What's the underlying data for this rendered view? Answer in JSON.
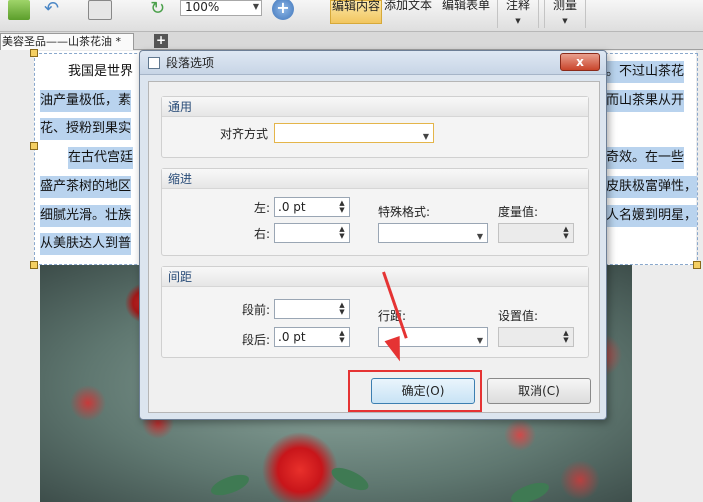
{
  "toolbar": {
    "zoom": "100%",
    "edit_content": "编辑内容",
    "add_text": "添加文本",
    "edit_form": "编辑表单",
    "annotate": "注释",
    "measure": "测量"
  },
  "tabs": {
    "doc_tab": "美容圣品——山茶花油 *",
    "add": "+"
  },
  "document": {
    "lines": [
      "我国是世界",
      "。不过山茶花",
      "油产量极低，素",
      "而山茶果从开",
      "花、授粉到果实",
      "在古代宫廷",
      "奇效。在一些",
      "盛产茶树的地区",
      "皮肤极富弹性，",
      "细腻光滑。壮族",
      "人名媛到明星，",
      "从美肤达人到普"
    ]
  },
  "dialog": {
    "title": "段落选项",
    "close": "x",
    "sections": {
      "general": "通用",
      "indent": "缩进",
      "spacing": "间距"
    },
    "align_label": "对齐方式",
    "align_value": "",
    "left_label": "左:",
    "left_value": ".0 pt",
    "right_label": "右:",
    "right_value": "",
    "special_label": "特殊格式:",
    "measure_label": "度量值:",
    "before_label": "段前:",
    "before_value": "",
    "after_label": "段后:",
    "after_value": ".0 pt",
    "line_spacing_label": "行距:",
    "set_value_label": "设置值:",
    "ok": "确定(O)",
    "cancel": "取消(C)"
  },
  "colors": {
    "highlight": "#b9d3ee",
    "annotation": "#e53333"
  }
}
